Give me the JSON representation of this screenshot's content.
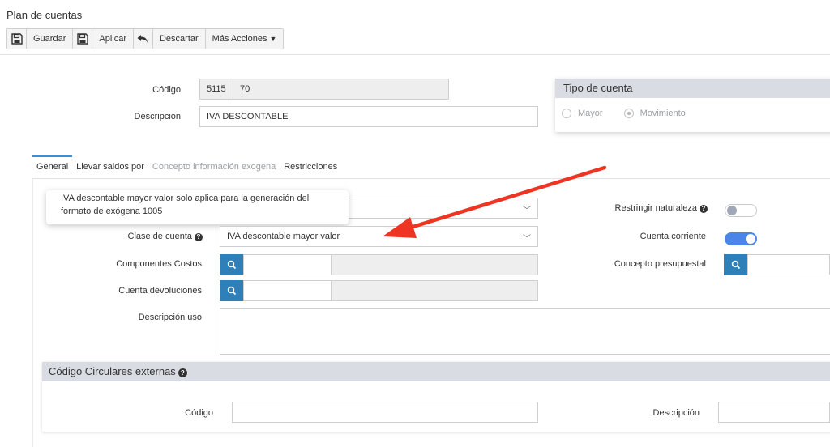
{
  "page": {
    "title": "Plan de cuentas"
  },
  "toolbar": {
    "save_label": "Guardar",
    "apply_label": "Aplicar",
    "discard_label": "Descartar",
    "more_label": "Más Acciones"
  },
  "form": {
    "codigo_label": "Código",
    "codigo_prefix": "5115",
    "codigo_suffix": "70",
    "descripcion_label": "Descripción",
    "descripcion_value": "IVA DESCONTABLE"
  },
  "tipo_cuenta": {
    "title": "Tipo de cuenta",
    "options": [
      "Mayor",
      "Movimiento"
    ],
    "selected": "Movimiento"
  },
  "tabs": [
    {
      "label": "General",
      "active": true
    },
    {
      "label": "Llevar saldos por",
      "active": false
    },
    {
      "label": "Concepto información exogena",
      "disabled": true
    },
    {
      "label": "Restricciones",
      "active": false
    }
  ],
  "general": {
    "tooltip_text": "IVA descontable mayor valor solo aplica para la generación del formato de exógena 1005",
    "clase_label": "Clase de cuenta",
    "clase_value": "IVA descontable mayor valor",
    "componentes_label": "Componentes Costos",
    "devoluciones_label": "Cuenta devoluciones",
    "descripcion_uso_label": "Descripción uso",
    "restringir_label": "Restringir naturaleza",
    "restringir_on": false,
    "corriente_label": "Cuenta corriente",
    "corriente_on": true,
    "presupuestal_label": "Concepto presupuestal"
  },
  "circulares": {
    "title": "Código Circulares externas",
    "codigo_label": "Código",
    "descripcion_label": "Descripción"
  },
  "colors": {
    "accent": "#3b8fd6",
    "search_button": "#2f7fb9",
    "toggle_on": "#4a86e8",
    "annotation_arrow": "#ee3524",
    "panel_header": "#d9dde3"
  }
}
